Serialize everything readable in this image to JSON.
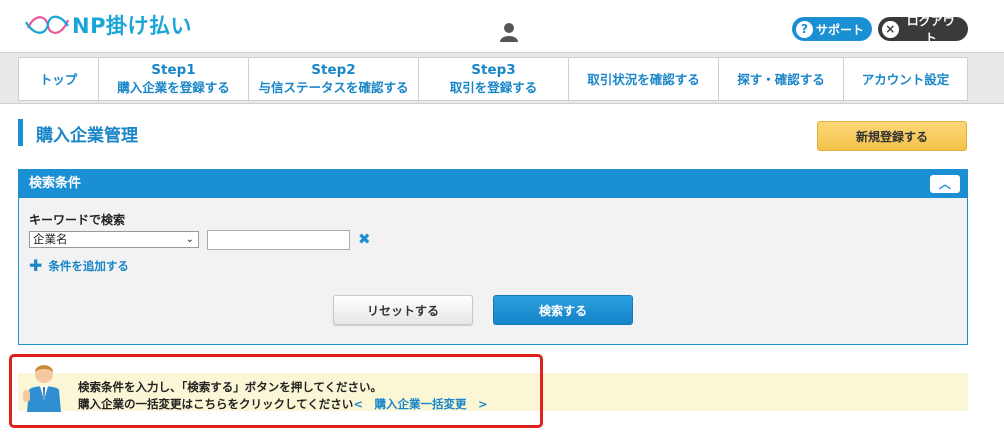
{
  "header": {
    "logo_text": "NP掛け払い",
    "support_label": "サポート",
    "logout_label": "ログアウト"
  },
  "nav": {
    "items": [
      {
        "step": "",
        "label": "トップ"
      },
      {
        "step": "Step1",
        "label": "購入企業を登録する"
      },
      {
        "step": "Step2",
        "label": "与信ステータスを確認する"
      },
      {
        "step": "Step3",
        "label": "取引を登録する"
      },
      {
        "step": "",
        "label": "取引状況を確認する"
      },
      {
        "step": "",
        "label": "探す・確認する"
      },
      {
        "step": "",
        "label": "アカウント設定"
      }
    ]
  },
  "page": {
    "title": "購入企業管理",
    "new_button": "新規登録する"
  },
  "search": {
    "panel_title": "検索条件",
    "keyword_label": "キーワードで検索",
    "field_selected": "企業名",
    "keyword_value": "",
    "add_condition": "条件を追加する",
    "reset_button": "リセットする",
    "search_button": "検索する"
  },
  "info": {
    "line1": "検索条件を入力し、「検索する」ボタンを押してください。",
    "line2_text": "購入企業の一括変更はこちらをクリックしてください",
    "line2_link": "<　購入企業一括変更　>"
  },
  "colors": {
    "brand_blue": "#1b8fd3",
    "accent_yellow": "#f5c24a",
    "highlight_red": "#e0201c"
  }
}
